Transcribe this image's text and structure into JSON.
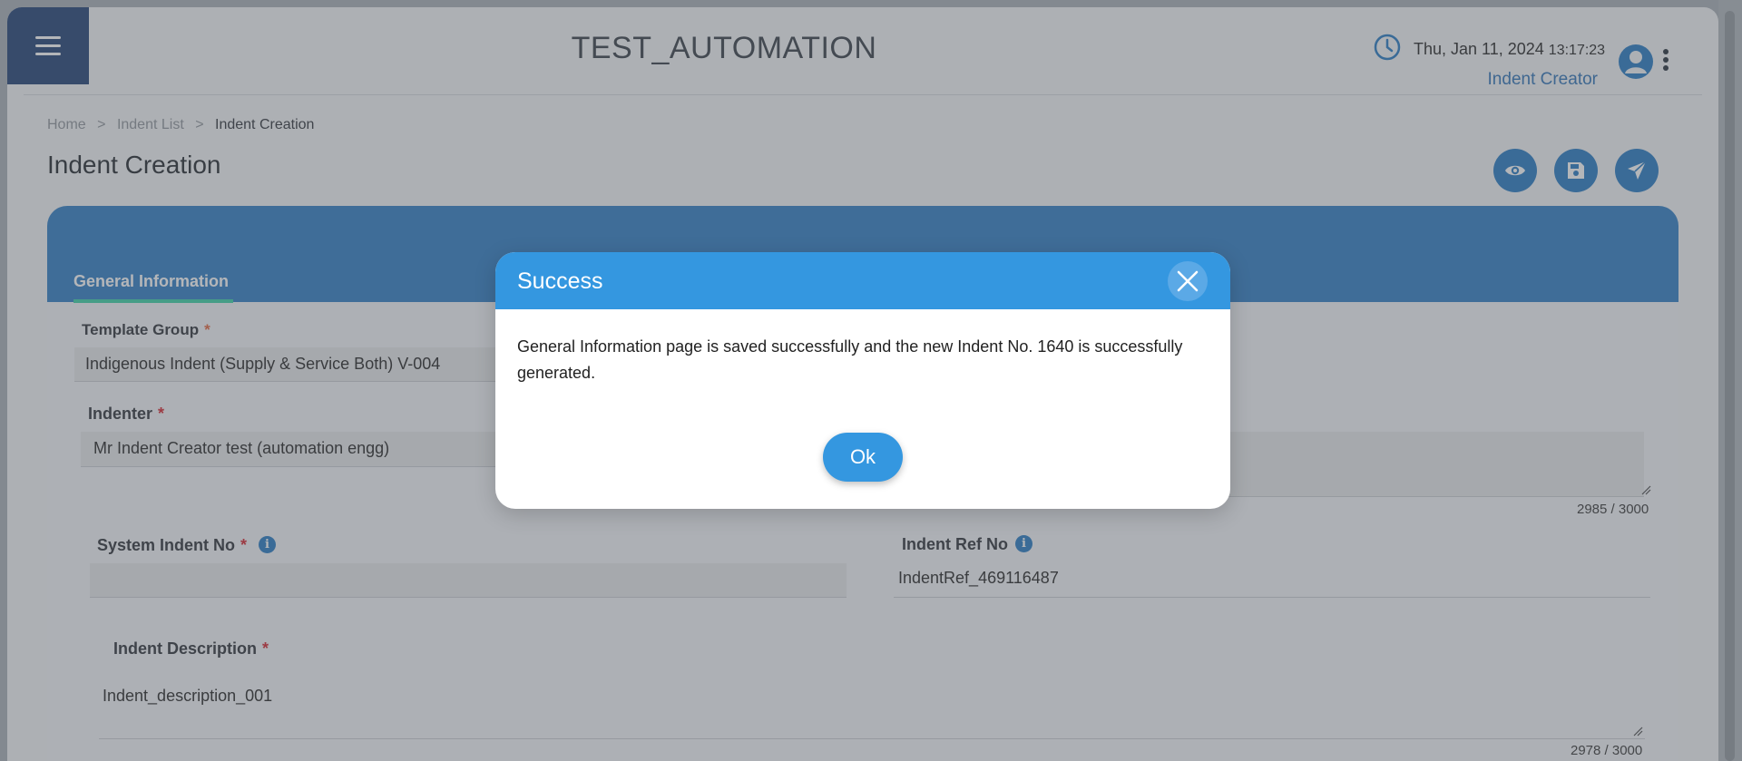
{
  "header": {
    "app_title": "TEST_AUTOMATION",
    "date": "Thu, Jan 11, 2024",
    "time": "13:17:23",
    "role": "Indent Creator",
    "icons": [
      "menu-icon",
      "clock-icon",
      "user-avatar-icon",
      "more-vert-icon"
    ]
  },
  "breadcrumb": {
    "items": [
      "Home",
      "Indent List",
      "Indent Creation"
    ],
    "separator": ">"
  },
  "page": {
    "title": "Indent Creation",
    "actions": [
      "preview-eye-icon",
      "save-icon",
      "submit-send-icon"
    ]
  },
  "tabs": {
    "active": "General Information"
  },
  "form": {
    "template_group": {
      "label": "Template Group",
      "value": "Indigenous Indent (Supply & Service Both) V-004"
    },
    "indenter": {
      "label": "Indenter",
      "value": "Mr Indent Creator test (automation engg)"
    },
    "right_counter": "2985 / 3000",
    "system_indent_no": {
      "label": "System Indent No",
      "value": ""
    },
    "indent_ref_no": {
      "label": "Indent Ref No",
      "value": "IndentRef_469116487"
    },
    "indent_description": {
      "label": "Indent Description",
      "value": "Indent_description_001",
      "counter": "2978 / 3000"
    },
    "required_mark": "*",
    "info_glyph": "i"
  },
  "modal": {
    "title": "Success",
    "message": "General Information page is saved successfully and the new Indent No. 1640 is successfully generated.",
    "ok_label": "Ok"
  },
  "colors": {
    "primary": "#2277c2",
    "navy": "#1d3d72",
    "modal_header": "#3497e0",
    "tab_underline": "#38d1a4",
    "required": "#d3202a"
  }
}
